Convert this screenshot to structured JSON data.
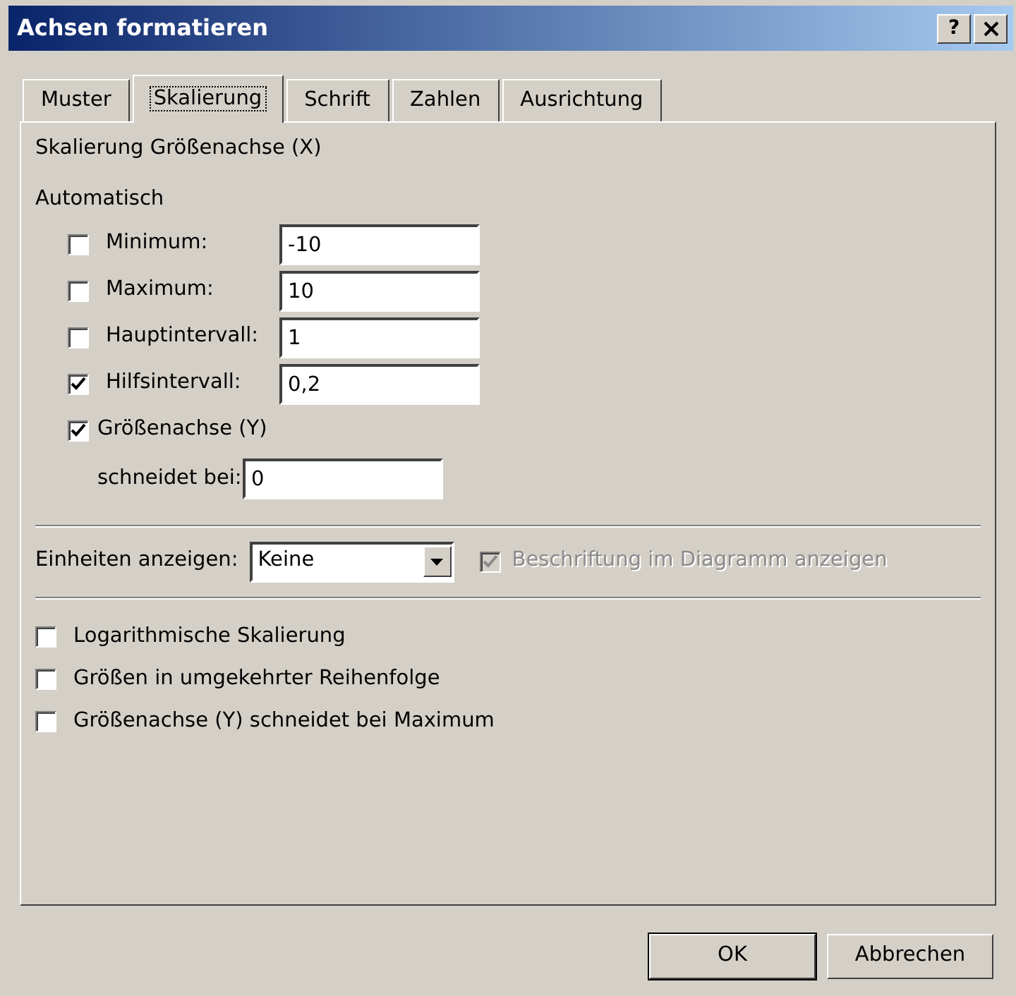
{
  "window": {
    "title": "Achsen formatieren",
    "help": "?"
  },
  "tabs": [
    {
      "label": "Muster",
      "selected": false
    },
    {
      "label": "Skalierung",
      "selected": true
    },
    {
      "label": "Schrift",
      "selected": false
    },
    {
      "label": "Zahlen",
      "selected": false
    },
    {
      "label": "Ausrichtung",
      "selected": false
    }
  ],
  "heading": "Skalierung Größenachse (X)",
  "auto_heading": "Automatisch",
  "auto_fields": [
    {
      "label": "Minimum:",
      "checked": false,
      "value": "-10"
    },
    {
      "label": "Maximum:",
      "checked": false,
      "value": "10"
    },
    {
      "label": "Hauptintervall:",
      "checked": false,
      "value": "1"
    },
    {
      "label": "Hilfsintervall:",
      "checked": true,
      "value": "0,2"
    }
  ],
  "crossing": {
    "label": "Größenachse (Y)",
    "checked": true,
    "field_label": "schneidet bei:",
    "value": "0"
  },
  "units": {
    "label": "Einheiten anzeigen:",
    "value": "Keine",
    "show_label": {
      "label": "Beschriftung im Diagramm anzeigen",
      "checked": true,
      "disabled": true
    }
  },
  "options": [
    {
      "label": "Logarithmische Skalierung",
      "checked": false
    },
    {
      "label": "Größen in umgekehrter Reihenfolge",
      "checked": false
    },
    {
      "label": "Größenachse (Y) schneidet bei Maximum",
      "checked": false
    }
  ],
  "buttons": [
    {
      "label": "OK",
      "default": true
    },
    {
      "label": "Abbrechen",
      "default": false
    }
  ]
}
